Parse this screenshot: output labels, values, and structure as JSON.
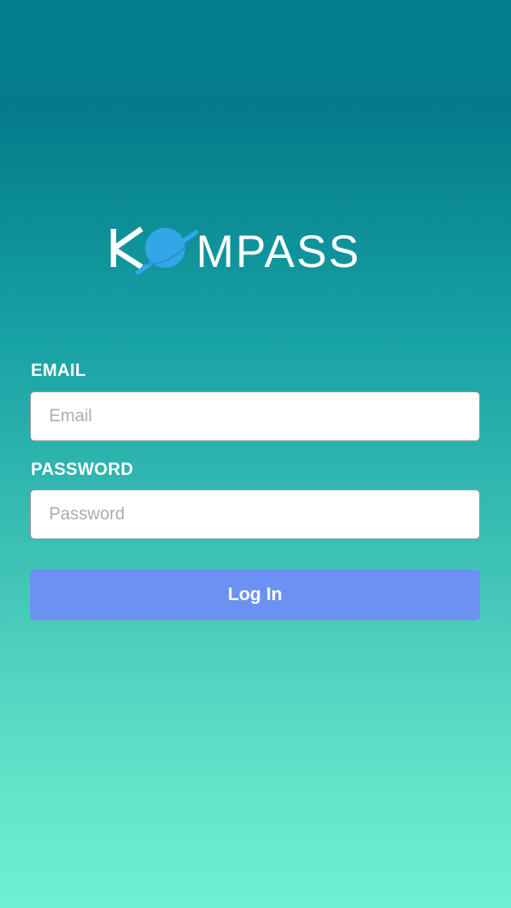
{
  "logo": {
    "text": "KOMPASS",
    "icon": "planet-icon",
    "text_color": "#ffffff",
    "planet_color": "#33a6e8"
  },
  "form": {
    "email": {
      "label": "EMAIL",
      "placeholder": "Email",
      "value": ""
    },
    "password": {
      "label": "PASSWORD",
      "placeholder": "Password",
      "value": ""
    },
    "submit_label": "Log In"
  },
  "colors": {
    "gradient_top": "#037d8d",
    "gradient_bottom": "#6ff0d2",
    "button": "#6b91f3"
  }
}
